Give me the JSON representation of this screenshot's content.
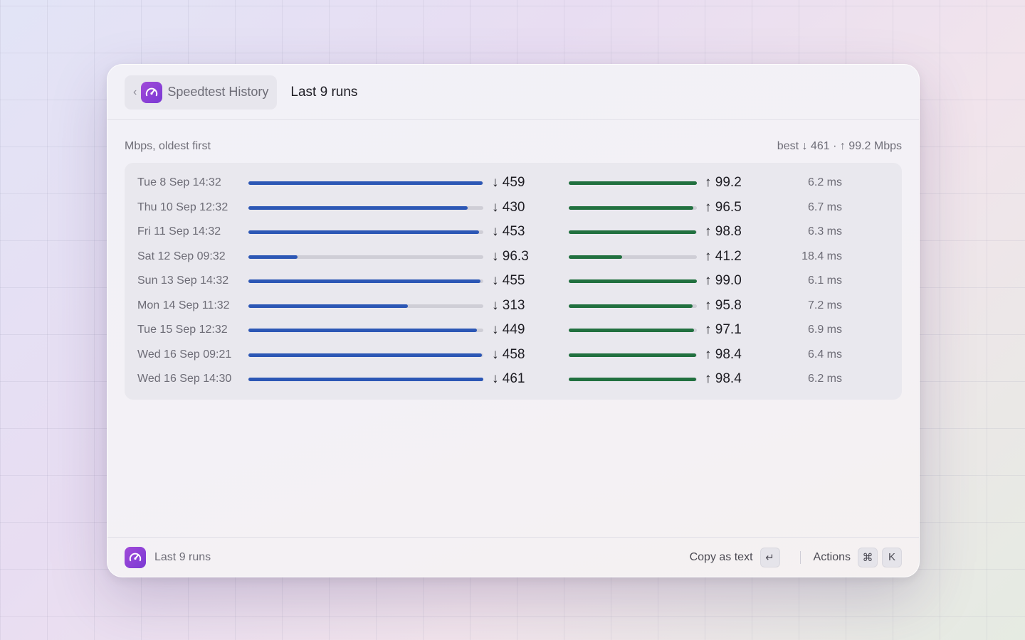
{
  "header": {
    "back_label": "Speedtest History",
    "title": "Last 9 runs"
  },
  "subheader": {
    "unit_note": "Mbps, oldest first",
    "best_summary": "best ↓ 461 · ↑ 99.2 Mbps"
  },
  "scale": {
    "download_max": 461,
    "upload_max": 99.2
  },
  "runs": [
    {
      "date": "Tue 8 Sep 14:32",
      "download": 459,
      "download_label": "↓ 459",
      "upload": 99.2,
      "upload_label": "↑ 99.2",
      "ping": "6.2 ms"
    },
    {
      "date": "Thu 10 Sep 12:32",
      "download": 430,
      "download_label": "↓ 430",
      "upload": 96.5,
      "upload_label": "↑ 96.5",
      "ping": "6.7 ms"
    },
    {
      "date": "Fri 11 Sep 14:32",
      "download": 453,
      "download_label": "↓ 453",
      "upload": 98.8,
      "upload_label": "↑ 98.8",
      "ping": "6.3 ms"
    },
    {
      "date": "Sat 12 Sep 09:32",
      "download": 96.3,
      "download_label": "↓ 96.3",
      "upload": 41.2,
      "upload_label": "↑ 41.2",
      "ping": "18.4 ms"
    },
    {
      "date": "Sun 13 Sep 14:32",
      "download": 455,
      "download_label": "↓ 455",
      "upload": 99.0,
      "upload_label": "↑ 99.0",
      "ping": "6.1 ms"
    },
    {
      "date": "Mon 14 Sep 11:32",
      "download": 313,
      "download_label": "↓ 313",
      "upload": 95.8,
      "upload_label": "↑ 95.8",
      "ping": "7.2 ms"
    },
    {
      "date": "Tue 15 Sep 12:32",
      "download": 449,
      "download_label": "↓ 449",
      "upload": 97.1,
      "upload_label": "↑ 97.1",
      "ping": "6.9 ms"
    },
    {
      "date": "Wed 16 Sep 09:21",
      "download": 458,
      "download_label": "↓ 458",
      "upload": 98.4,
      "upload_label": "↑ 98.4",
      "ping": "6.4 ms"
    },
    {
      "date": "Wed 16 Sep 14:30",
      "download": 461,
      "download_label": "↓ 461",
      "upload": 98.4,
      "upload_label": "↑ 98.4",
      "ping": "6.2 ms"
    }
  ],
  "footer": {
    "label": "Last 9 runs",
    "copy_label": "Copy as text",
    "copy_key": "↵",
    "actions_label": "Actions",
    "actions_keys": [
      "⌘",
      "K"
    ]
  },
  "icons": {
    "app": "speedometer-icon",
    "back": "chevron-left-icon"
  },
  "colors": {
    "download": "#2c57b5",
    "upload": "#21703f",
    "track": "#cfced6",
    "app_icon": "#8b3fd6"
  }
}
